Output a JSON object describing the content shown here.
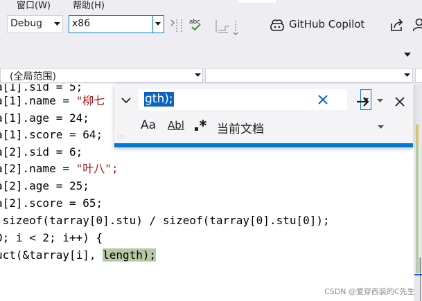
{
  "menu": {
    "window_label": "窗口(W)",
    "help_label": "帮助(H)"
  },
  "toolbar": {
    "configuration": "Debug",
    "platform": "x86",
    "copilot_label": "GitHub Copilot",
    "icons": [
      "breakpoint-dots-icon",
      "spell-check-icon",
      "step-icon",
      "copilot-icon",
      "share-icon",
      "person-icon",
      "overflow-chevron-icon"
    ]
  },
  "scope": {
    "first": "(全局范围)",
    "second": "",
    "third": ""
  },
  "editor": {
    "lines": [
      {
        "text": "a[1].sid = 5;",
        "string": ""
      },
      {
        "text": "a[1].name = ",
        "string": "\"柳七"
      },
      {
        "text": "a[1].age = 24;",
        "string": ""
      },
      {
        "text": "a[1].score = 64;",
        "string": ""
      },
      {
        "text": "a[2].sid = 6;",
        "string": ""
      },
      {
        "text": "a[2].name = ",
        "string": "\"叶八\";"
      },
      {
        "text": "a[2].age = 25;",
        "string": ""
      },
      {
        "text": "a[2].score = 65;",
        "string": ""
      },
      {
        "text": " sizeof(tarray[0].stu) / sizeof(tarray[0].stu[0]);",
        "string": ""
      },
      {
        "text": "0; i < 2; i++) {",
        "string": ""
      },
      {
        "text": "uct(&tarray[i], ",
        "string": ""
      }
    ],
    "highlight_text": "length);"
  },
  "find": {
    "query": "gth);",
    "scope_label": "当前文档",
    "case_label": "Aa",
    "word_label": "Abl",
    "grip": ":::"
  },
  "watermark": "CSDN @爱穿西装的C先生",
  "colors": {
    "accent": "#007acc",
    "selection": "#0b64c0",
    "match_highlight": "#b7c8a4",
    "string": "#a31515",
    "chrome": "#eeeef2"
  }
}
